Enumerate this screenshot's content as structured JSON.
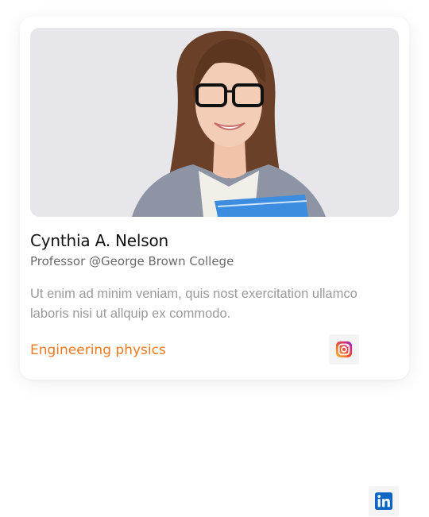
{
  "profile": {
    "name": "Cynthia A. Nelson",
    "role": "Professor @George Brown College",
    "bio": "Ut enim ad minim veniam, quis nost exercitation ullamco laboris nisi ut allquip ex commodo.",
    "department": "Engineering physics"
  },
  "social": {
    "instagram_icon": "instagram-icon",
    "linkedin_icon": "linkedin-icon"
  },
  "colors": {
    "accent": "#f07a21",
    "name": "#111111",
    "role": "#6b6b6b",
    "bio": "#9a9a9a",
    "linkedin": "#0a66c2"
  }
}
